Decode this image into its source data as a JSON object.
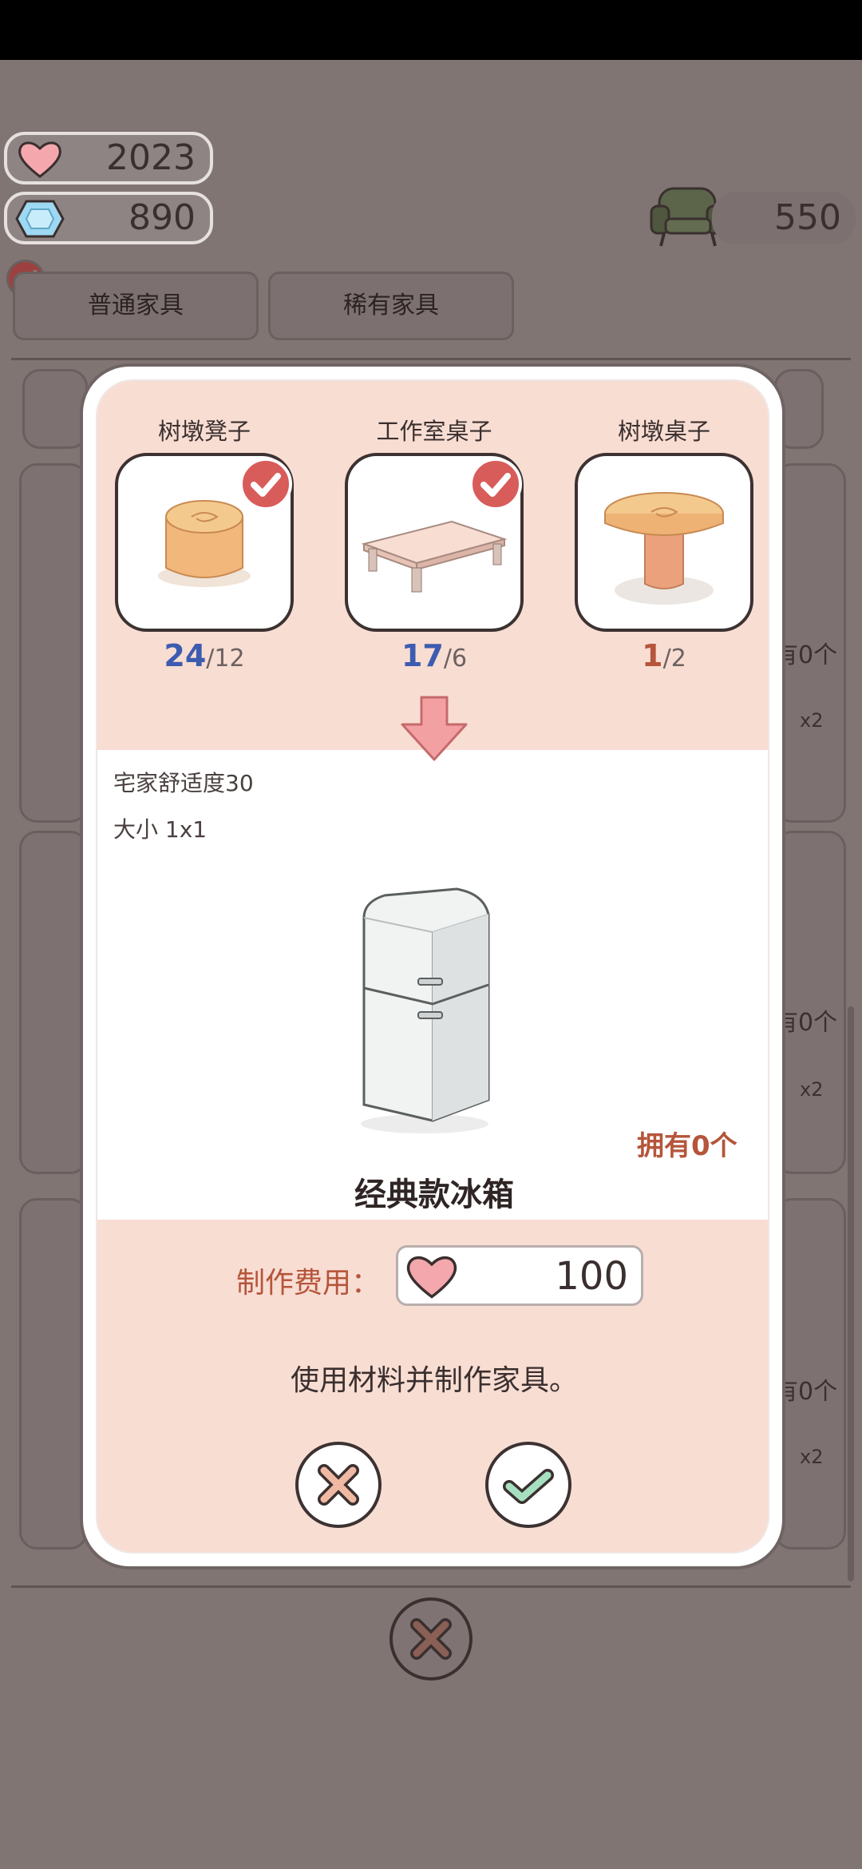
{
  "resources": {
    "hearts": "2023",
    "gems": "890",
    "chairs": "550"
  },
  "tabs": [
    {
      "label": "普通家具"
    },
    {
      "label": "稀有家具"
    }
  ],
  "background_owned": [
    "有0个",
    "有0个",
    "有0个"
  ],
  "background_qty": [
    "x2",
    "x2",
    "x2",
    "x2",
    "x2",
    "x2"
  ],
  "materials": [
    {
      "name": "树墩凳子",
      "have": "24",
      "need": "/12",
      "checked": true
    },
    {
      "name": "工作室桌子",
      "have": "17",
      "need": "/6",
      "checked": true
    },
    {
      "name": "树墩桌子",
      "have": "1",
      "need": "/2",
      "checked": false
    }
  ],
  "item": {
    "comfort": "宅家舒适度30",
    "size": "大小 1x1",
    "owned": "拥有0个",
    "name": "经典款冰箱"
  },
  "cost": {
    "label": "制作费用：",
    "value": "100"
  },
  "description": "使用材料并制作家具。",
  "colors": {
    "accent_red": "#d85c5a",
    "have_ok": "#3d5cb0",
    "have_short": "#b5553b",
    "pink_panel": "#f8ddd3"
  }
}
